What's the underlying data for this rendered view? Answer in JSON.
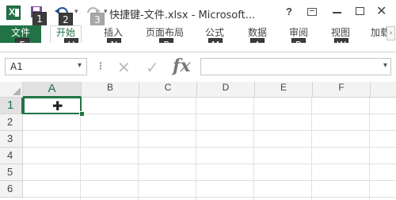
{
  "title_bar": {
    "app_icon_letter": "X",
    "title": "快捷键-文件.xlsx - Microsoft...",
    "help_label": "?",
    "close_label": "✕"
  },
  "quick_access": {
    "save_keytip": "1",
    "undo_keytip": "2",
    "redo_keytip": "3"
  },
  "ribbon": {
    "tabs": [
      {
        "label": "文件",
        "keytip": "F"
      },
      {
        "label": "开始",
        "keytip": "H"
      },
      {
        "label": "插入",
        "keytip": "N"
      },
      {
        "label": "页面布局",
        "keytip": "P"
      },
      {
        "label": "公式",
        "keytip": "M"
      },
      {
        "label": "数据",
        "keytip": "A"
      },
      {
        "label": "审阅",
        "keytip": "R"
      },
      {
        "label": "视图",
        "keytip": "W"
      },
      {
        "label": "加载",
        "keytip": ""
      }
    ],
    "scroll_right_glyph": "›"
  },
  "formula_bar": {
    "name_box_value": "A1",
    "cancel_glyph": "✕",
    "enter_glyph": "✓",
    "fx_label": "fx",
    "formula_value": ""
  },
  "grid": {
    "columns": [
      "A",
      "B",
      "C",
      "D",
      "E",
      "F"
    ],
    "rows": [
      "1",
      "2",
      "3",
      "4",
      "5",
      "6"
    ],
    "active_cell": "A1"
  },
  "colors": {
    "accent": "#217346",
    "keytip_bg": "#3c3c3c",
    "header_bg": "#f3f3f3",
    "gridline": "#e1e1e1"
  },
  "icons": {
    "app": "excel-icon",
    "save": "save-icon",
    "undo": "undo-icon",
    "redo": "redo-icon",
    "cursor": "cell-cross-cursor-icon"
  }
}
